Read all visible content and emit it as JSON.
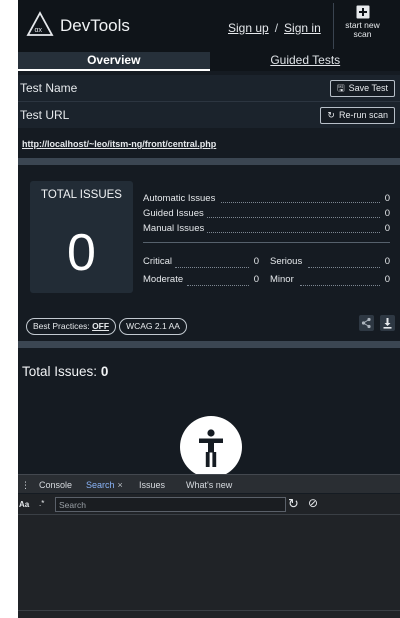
{
  "header": {
    "brand": "DevTools",
    "signup": "Sign up",
    "separator": "/",
    "signin": "Sign in",
    "new_scan_line1": "start new",
    "new_scan_line2": "scan"
  },
  "tabs": [
    {
      "label": "Overview",
      "active": true
    },
    {
      "label": "Guided Tests",
      "active": false
    }
  ],
  "test_name": {
    "label": "Test Name",
    "button": "Save Test"
  },
  "test_url": {
    "label": "Test URL",
    "button": "Re-run scan",
    "url": "http://localhost/~leo/itsm-ng/front/central.php"
  },
  "summary": {
    "title": "TOTAL ISSUES",
    "total": "0",
    "automatic": {
      "label": "Automatic Issues",
      "value": "0"
    },
    "guided": {
      "label": "Guided Issues",
      "value": "0"
    },
    "manual": {
      "label": "Manual Issues",
      "value": "0"
    },
    "critical": {
      "label": "Critical",
      "value": "0"
    },
    "serious": {
      "label": "Serious",
      "value": "0"
    },
    "moderate": {
      "label": "Moderate",
      "value": "0"
    },
    "minor": {
      "label": "Minor",
      "value": "0"
    }
  },
  "badges": {
    "best_practices_label": "Best Practices:",
    "best_practices_value": "OFF",
    "standard": "WCAG 2.1 AA"
  },
  "issues": {
    "label": "Total Issues:",
    "value": "0"
  },
  "console": {
    "tabs": [
      "Console",
      "Search",
      "Issues",
      "What's new"
    ],
    "active_tab": "Search",
    "close": "×",
    "match_case": "Aa",
    "regex": ".*",
    "search_placeholder": "Search"
  },
  "colors": {
    "panel_bg": "#151b22",
    "header_bg": "#0f1419",
    "active_console_tab": "#8ab4f8"
  }
}
